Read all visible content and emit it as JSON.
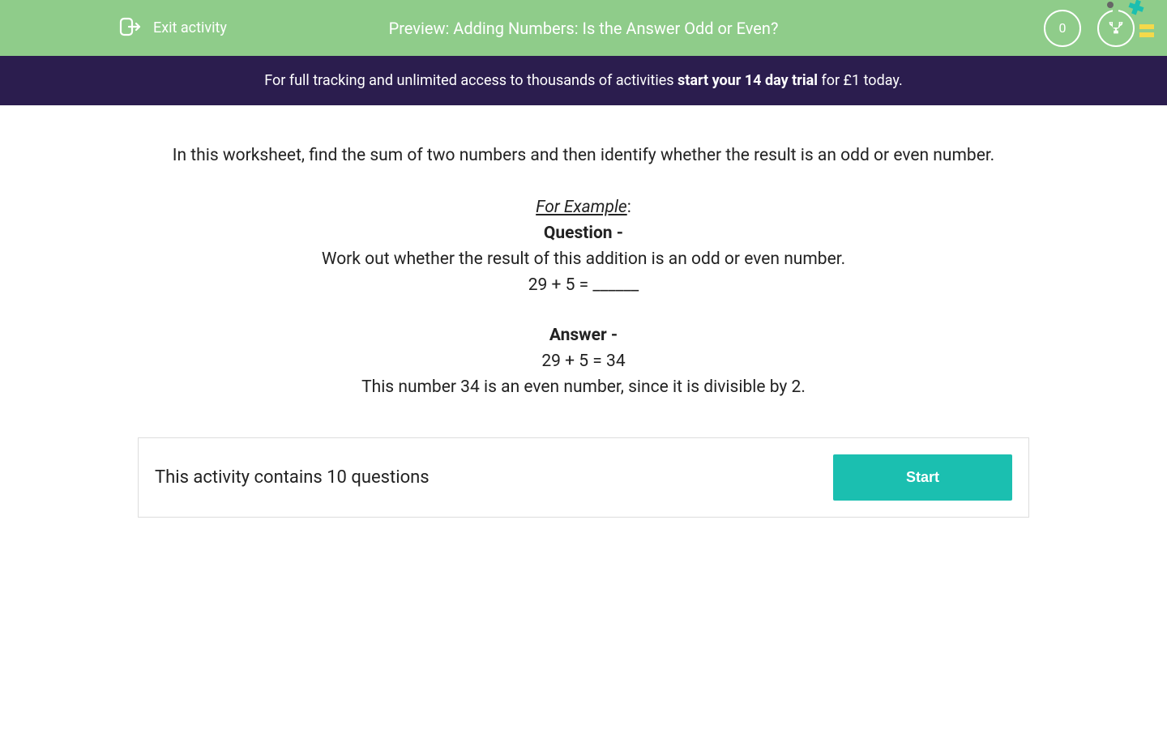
{
  "header": {
    "exit_label": "Exit activity",
    "title": "Preview: Adding Numbers: Is the Answer Odd or Even?",
    "points": "0"
  },
  "promo": {
    "prefix": "For full tracking and unlimited access to thousands of activities ",
    "bold": "start your 14 day trial",
    "suffix": " for £1 today."
  },
  "content": {
    "intro": "In this worksheet, find the sum of two numbers and then identify whether the result is an odd or even number.",
    "example_label": "For Example",
    "example_colon": ":",
    "question_label": "Question - ",
    "question_prompt": "Work out whether the result of this addition is an odd or even number.",
    "question_expr": "29   +  5   =   ______",
    "answer_label": "Answer -",
    "answer_expr": "29   +  5  =  34",
    "answer_explain": "This number 34 is an even number, since it is divisible by 2."
  },
  "action": {
    "text": "This activity contains 10 questions",
    "button": "Start"
  }
}
